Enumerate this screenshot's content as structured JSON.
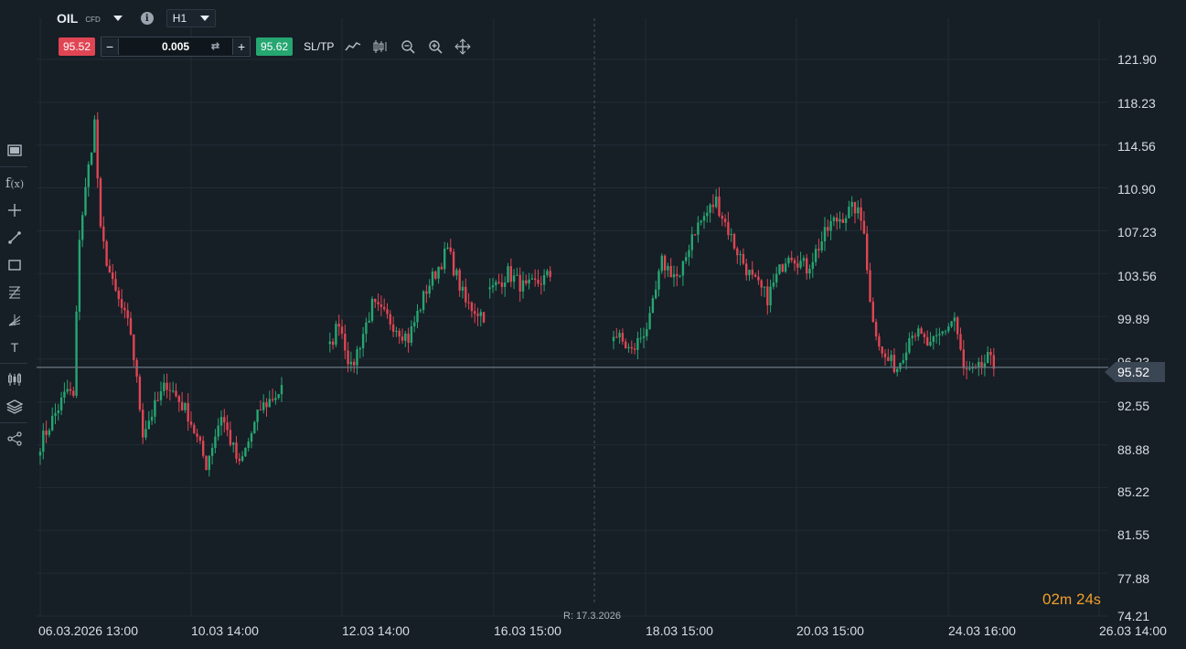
{
  "header": {
    "symbol": "OIL",
    "symbol_type": "CFD",
    "info_icon": "i",
    "timeframe": "H1"
  },
  "trade_bar": {
    "sell_price": "95.52",
    "buy_price": "95.62",
    "minus": "−",
    "plus": "+",
    "quantity": "0.005",
    "sltp_label": "SL/TP",
    "tools": [
      "line-chart-icon",
      "candles-icon",
      "zoom-out-icon",
      "zoom-in-icon",
      "move-icon"
    ]
  },
  "sidebar": {
    "items": [
      "window-icon",
      "function-icon",
      "crosshair-icon",
      "trendline-icon",
      "rectangle-icon",
      "fibonacci-icon",
      "pitchfork-icon",
      "text-icon",
      "indicators-icon",
      "layers-icon",
      "share-icon"
    ]
  },
  "axis": {
    "y_ticks": [
      "121.90",
      "118.23",
      "114.56",
      "110.90",
      "107.23",
      "103.56",
      "99.89",
      "96.23",
      "92.55",
      "88.88",
      "85.22",
      "81.55",
      "77.88",
      "74.21"
    ],
    "x_ticks": [
      "06.03.2026 13:00",
      "10.03 14:00",
      "12.03 14:00",
      "16.03 15:00",
      "18.03 15:00",
      "20.03 15:00",
      "24.03 16:00",
      "26.03 14:00"
    ]
  },
  "current_price": "95.52",
  "reference_date": "R: 17.3.2026",
  "countdown": {
    "minutes": "02",
    "min_unit": "m",
    "seconds": "24",
    "sec_unit": "s"
  },
  "colors": {
    "up": "#26a671",
    "down": "#e04553",
    "background": "#161e26",
    "grid": "#222c35",
    "price_line": "#6b7884",
    "countdown": "#f0a028"
  },
  "chart_data": {
    "type": "candlestick",
    "ylim": [
      74.21,
      121.9
    ],
    "anchors": [
      {
        "x": 0,
        "y": 89
      },
      {
        "x": 9,
        "y": 93.6
      },
      {
        "x": 11,
        "y": 92.9
      },
      {
        "x": 13,
        "y": 106.8
      },
      {
        "x": 18,
        "y": 116.5
      },
      {
        "x": 20,
        "y": 107
      },
      {
        "x": 24,
        "y": 102.5
      },
      {
        "x": 30,
        "y": 98.5
      },
      {
        "x": 34,
        "y": 90
      },
      {
        "x": 42,
        "y": 94.2
      },
      {
        "x": 49,
        "y": 91.5
      },
      {
        "x": 55,
        "y": 87.2
      },
      {
        "x": 60,
        "y": 91.5
      },
      {
        "x": 66,
        "y": 87
      },
      {
        "x": 73,
        "y": 92
      },
      {
        "x": 80,
        "y": 93.6
      },
      {
        "x": 82,
        "y": null
      },
      {
        "x": 95,
        "y": null
      },
      {
        "x": 96,
        "y": 97.2
      },
      {
        "x": 99,
        "y": 99.6
      },
      {
        "x": 103,
        "y": 95.3
      },
      {
        "x": 110,
        "y": 100.8
      },
      {
        "x": 116,
        "y": 99.5
      },
      {
        "x": 122,
        "y": 98
      },
      {
        "x": 128,
        "y": 102.2
      },
      {
        "x": 135,
        "y": 105.6
      },
      {
        "x": 141,
        "y": 101
      },
      {
        "x": 147,
        "y": 100
      },
      {
        "x": 148,
        "y": null
      },
      {
        "x": 149,
        "y": 102
      },
      {
        "x": 155,
        "y": 103.6
      },
      {
        "x": 161,
        "y": 102.2
      },
      {
        "x": 169,
        "y": 103.4
      },
      {
        "x": 171,
        "y": null
      },
      {
        "x": 189,
        "y": null
      },
      {
        "x": 190,
        "y": 98.5
      },
      {
        "x": 196,
        "y": 96.8
      },
      {
        "x": 202,
        "y": 99.5
      },
      {
        "x": 206,
        "y": 104.5
      },
      {
        "x": 212,
        "y": 103
      },
      {
        "x": 216,
        "y": 107
      },
      {
        "x": 224,
        "y": 109.8
      },
      {
        "x": 230,
        "y": 106
      },
      {
        "x": 236,
        "y": 103
      },
      {
        "x": 241,
        "y": 101.5
      },
      {
        "x": 248,
        "y": 105.5
      },
      {
        "x": 254,
        "y": 104
      },
      {
        "x": 262,
        "y": 107.8
      },
      {
        "x": 270,
        "y": 109.2
      },
      {
        "x": 273,
        "y": 107.5
      },
      {
        "x": 275,
        "y": 101
      },
      {
        "x": 279,
        "y": 96.5
      },
      {
        "x": 284,
        "y": 95.5
      },
      {
        "x": 289,
        "y": 98.8
      },
      {
        "x": 295,
        "y": 97.2
      },
      {
        "x": 303,
        "y": 99.8
      },
      {
        "x": 306,
        "y": 95.2
      },
      {
        "x": 310,
        "y": 95
      },
      {
        "x": 314,
        "y": 96.2
      },
      {
        "x": 316,
        "y": 95.6
      }
    ]
  }
}
